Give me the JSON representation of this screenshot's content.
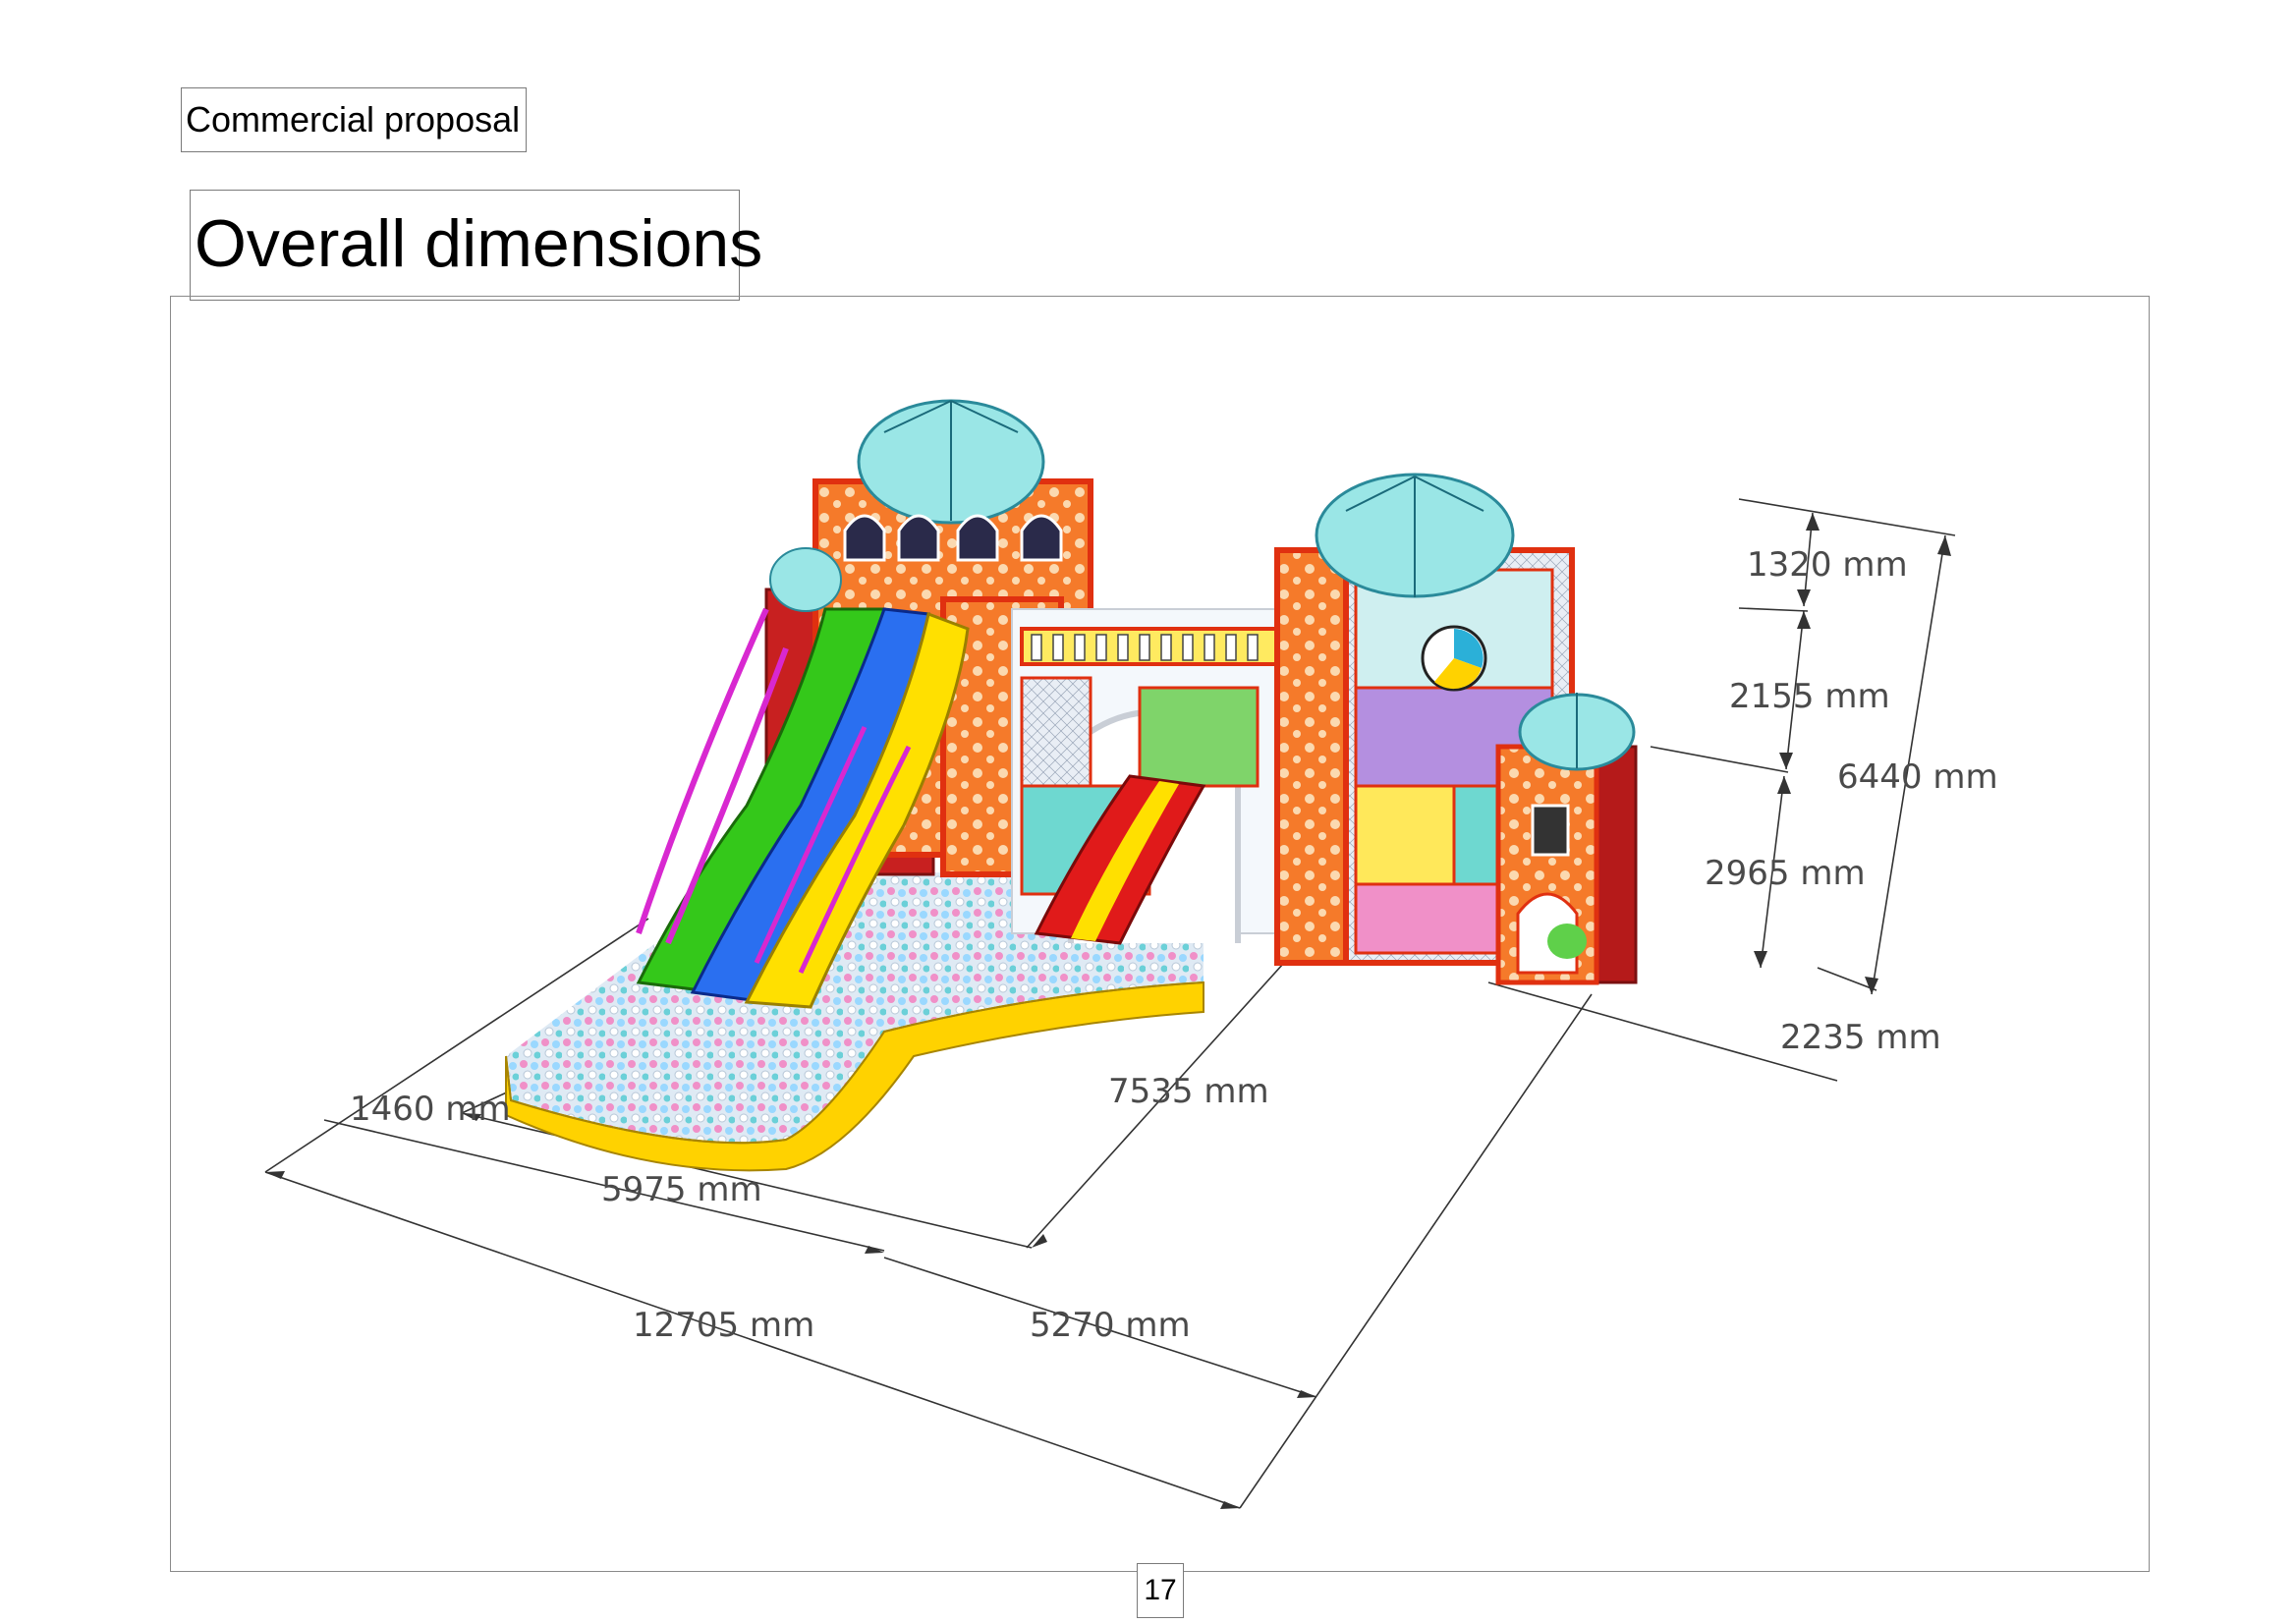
{
  "header": {
    "label": "Commercial proposal"
  },
  "page": {
    "title": "Overall dimensions",
    "number": "17"
  },
  "dimensions": {
    "top_dome_height": "1320 mm",
    "upper_level_height": "2155 mm",
    "total_height": "6440 mm",
    "lower_level_height": "2965 mm",
    "side_tower_depth": "2235 mm",
    "central_depth": "7535 mm",
    "pool_edge": "1460 mm",
    "pool_width": "5975 mm",
    "total_length": "12705 mm",
    "right_section": "5270 mm"
  },
  "colors": {
    "frame_orange": "#f4501e",
    "dome_cyan": "#9ae6e6",
    "slide_green": "#34c81a",
    "slide_blue": "#2a6ff0",
    "slide_yellow": "#ffe000",
    "slide_red": "#e01a1a",
    "ball_pink": "#f090c8",
    "pool_yellow": "#ffd200"
  }
}
